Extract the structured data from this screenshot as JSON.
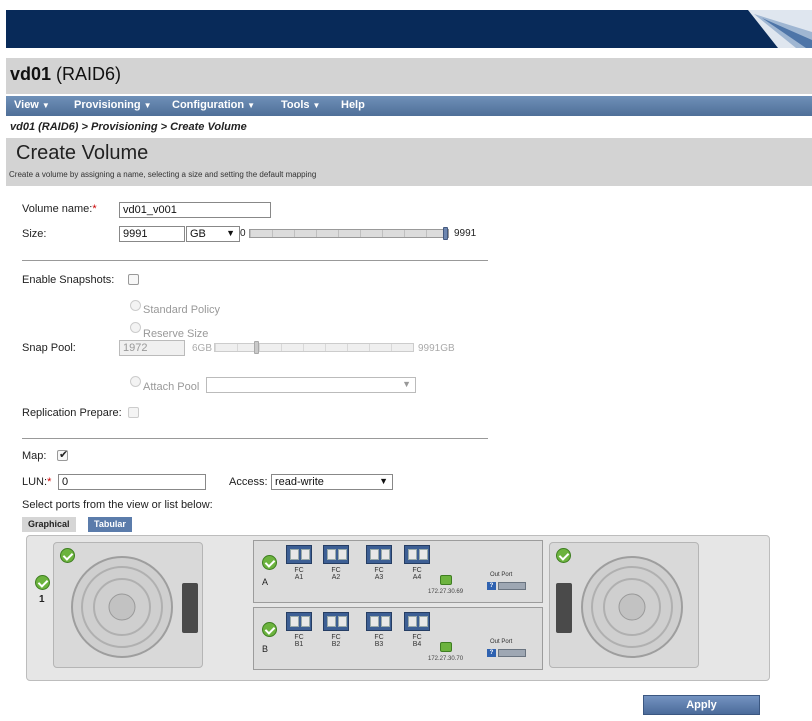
{
  "title": {
    "name": "vd01",
    "raid": "(RAID6)"
  },
  "menu": [
    {
      "label": "View",
      "caret": "▼"
    },
    {
      "label": "Provisioning",
      "caret": "▼"
    },
    {
      "label": "Configuration",
      "caret": "▼"
    },
    {
      "label": "Tools",
      "caret": "▼"
    },
    {
      "label": "Help",
      "caret": ""
    }
  ],
  "breadcrumb": "vd01 (RAID6) > Provisioning > Create Volume",
  "header": {
    "title": "Create Volume",
    "description": "Create a volume by assigning a name, selecting a size and setting the default mapping"
  },
  "form": {
    "volume_name": {
      "label": "Volume name:",
      "required": "*",
      "value": "vd01_v001"
    },
    "size": {
      "label": "Size:",
      "value": "9991",
      "unit": "GB",
      "min": "0",
      "max": "9991",
      "slider_fraction": 1.0
    },
    "enable_snapshots": {
      "label": "Enable Snapshots:",
      "checked": false
    },
    "snap_pool": {
      "label": "Snap Pool:",
      "standard_policy": "Standard Policy",
      "reserve_size": "Reserve Size",
      "reserve_value": "1972",
      "min": "6GB",
      "max": "9991GB",
      "slider_fraction": 0.2,
      "attach_pool": "Attach Pool",
      "attach_pool_value": ""
    },
    "replication_prepare": {
      "label": "Replication Prepare:",
      "checked": false
    },
    "map": {
      "label": "Map:",
      "checked": true,
      "checkmark": "✔"
    },
    "lun": {
      "label": "LUN:",
      "required": "*",
      "value": "0"
    },
    "access": {
      "label": "Access:",
      "value": "read-write"
    },
    "select_ports": "Select ports from the view or list below:"
  },
  "tabs": [
    {
      "label": "Graphical",
      "active": true
    },
    {
      "label": "Tabular",
      "active": false
    }
  ],
  "enclosure": {
    "slot_number": "1",
    "controllers": [
      {
        "letter": "A",
        "ports": [
          "A1",
          "A2",
          "A3",
          "A4"
        ],
        "port_type": "FC",
        "ip": "172.27.30.69",
        "out_port": "Out Port"
      },
      {
        "letter": "B",
        "ports": [
          "B1",
          "B2",
          "B3",
          "B4"
        ],
        "port_type": "FC",
        "ip": "172.27.30.70",
        "out_port": "Out Port"
      }
    ],
    "help_glyph": "?"
  },
  "apply_label": "Apply",
  "arrow_glyph": "▼",
  "colors": {
    "banner": "#082a59",
    "menu": "#5b7cab",
    "status_ok": "#6cb33e",
    "port": "#3d5f94"
  }
}
